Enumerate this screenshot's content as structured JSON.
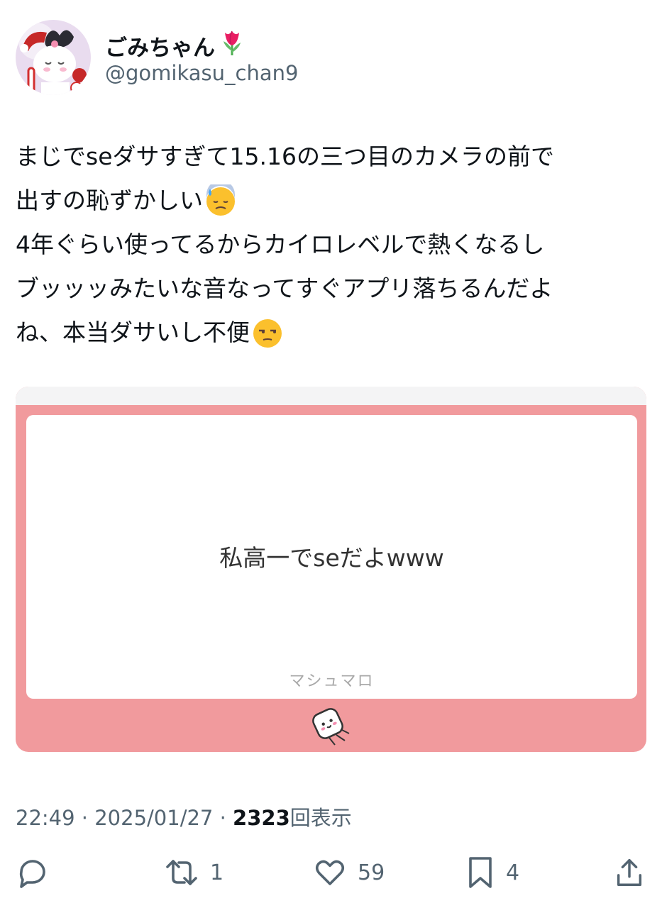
{
  "author": {
    "display_name": "ごみちゃん",
    "display_name_emoji": "tulip-icon",
    "handle": "@gomikasu_chan9"
  },
  "tweet": {
    "lines": [
      "まじでseダサすぎて15.16の三つ目のカメラの前で",
      "出すの恥ずかしい",
      "4年ぐらい使ってるからカイロレベルで熱くなるし",
      "ブッッッみたいな音なってすぐアプリ落ちるんだよ",
      "ね、本当ダサいし不便"
    ],
    "emojis": [
      "downcast-sweat-face-icon",
      "unamused-face-icon"
    ]
  },
  "media": {
    "question": "私高一でseだよwww",
    "brand": "マシュマロ",
    "colors": {
      "frame": "#f19a9d",
      "strip": "#f4f4f5"
    }
  },
  "meta": {
    "time": "22:49",
    "date": "2025/01/27",
    "views": "2323",
    "views_label": "回表示"
  },
  "actions": {
    "reply_count": "",
    "retweet_count": "1",
    "like_count": "59",
    "bookmark_count": "4"
  },
  "colors": {
    "text": "#0f1419",
    "secondary": "#536471"
  }
}
